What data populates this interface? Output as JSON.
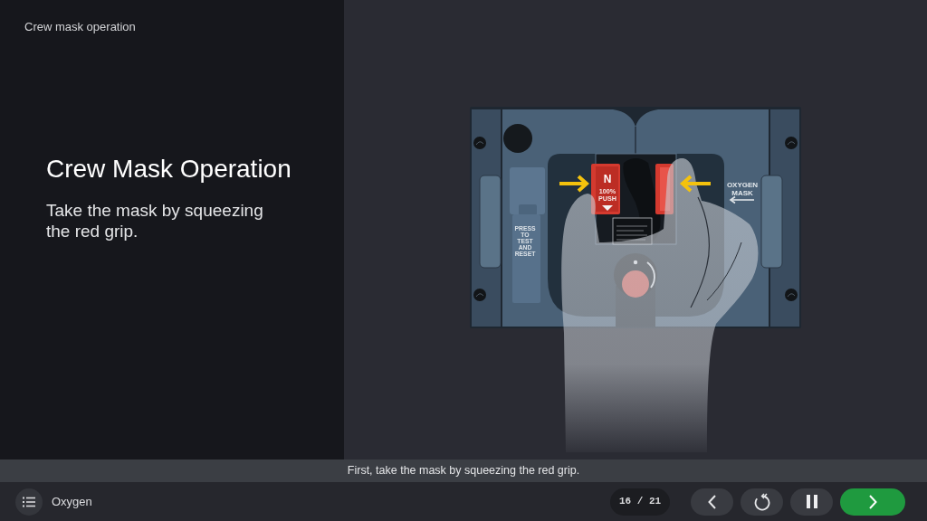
{
  "header": {
    "breadcrumb": "Crew mask operation"
  },
  "slide": {
    "title": "Crew Mask Operation",
    "body": "Take the mask by squeezing the red grip."
  },
  "illustration": {
    "lever_label": "PRESS TO TEST AND RESET",
    "grip_letter": "N",
    "grip_label": "100% PUSH",
    "stowage_label": "OXYGEN MASK"
  },
  "caption": "First, take the mask by squeezing the red grip.",
  "footer": {
    "chapter": "Oxygen",
    "counter": "16 / 21",
    "buttons": [
      {
        "kind": "prev"
      },
      {
        "kind": "replay"
      },
      {
        "kind": "pause"
      },
      {
        "kind": "next"
      }
    ]
  }
}
